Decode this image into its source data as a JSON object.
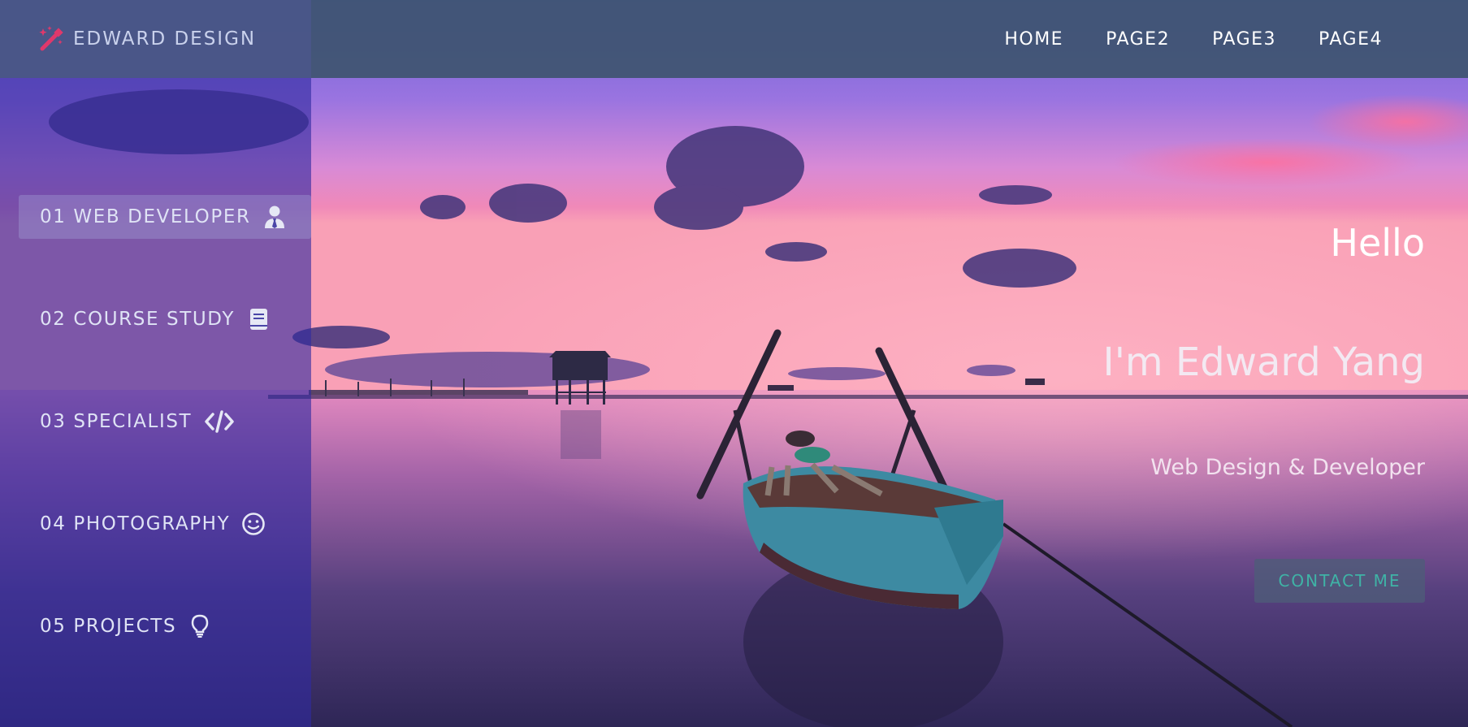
{
  "brand": {
    "name": "EDWARD DESIGN",
    "icon": "magic-wand-icon",
    "icon_color": "#e0386b"
  },
  "nav": {
    "items": [
      {
        "label": "HOME"
      },
      {
        "label": "PAGE2"
      },
      {
        "label": "PAGE3"
      },
      {
        "label": "PAGE4"
      }
    ]
  },
  "sidebar": {
    "items": [
      {
        "label": "01 WEB DEVELOPER",
        "icon": "user-tie-icon",
        "active": true
      },
      {
        "label": "02 COURSE STUDY",
        "icon": "book-icon",
        "active": false
      },
      {
        "label": "03 SPECIALIST",
        "icon": "code-icon",
        "active": false
      },
      {
        "label": "04 PHOTOGRAPHY",
        "icon": "smile-icon",
        "active": false
      },
      {
        "label": "05 PROJECTS",
        "icon": "lightbulb-icon",
        "active": false
      }
    ]
  },
  "hero": {
    "greeting": "Hello",
    "name": "I'm Edward Yang",
    "subtitle": "Web Design & Developer",
    "cta_label": "CONTACT ME"
  },
  "colors": {
    "topbar": "#3e5470",
    "sidebar": "#302aa0",
    "cta_text": "#3fb3a6"
  }
}
